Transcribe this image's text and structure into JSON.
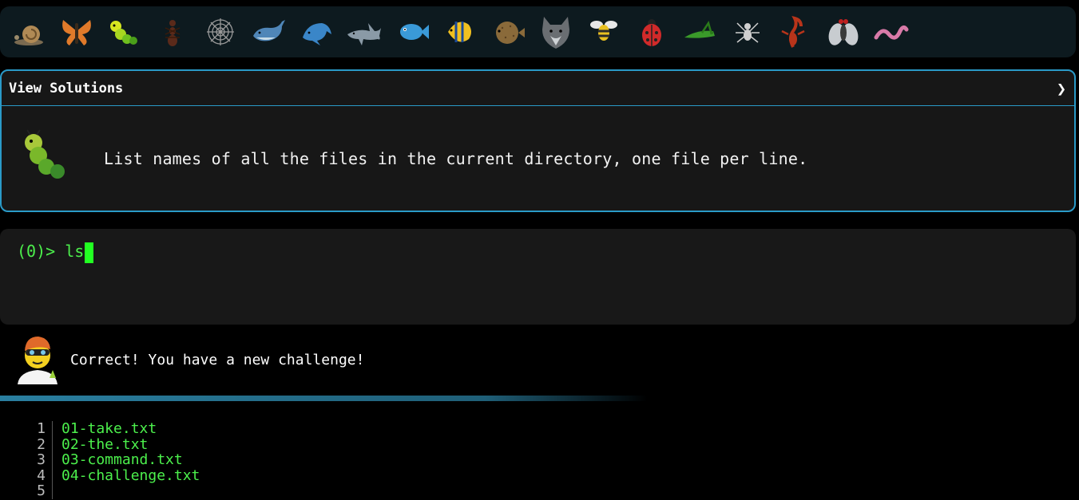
{
  "animal_bar": {
    "animals": [
      "snail-icon",
      "butterfly-icon",
      "caterpillar-icon",
      "ant-icon",
      "spider-web-icon",
      "whale-icon",
      "dolphin-icon",
      "shark-icon",
      "fish-icon",
      "tropical-fish-icon",
      "pufferfish-icon",
      "wolf-icon",
      "bee-icon",
      "ladybug-icon",
      "grasshopper-icon",
      "spider-icon",
      "scorpion-icon",
      "fly-icon",
      "worm-icon"
    ]
  },
  "solutions": {
    "title": "View Solutions",
    "toggle": "❯"
  },
  "challenge": {
    "icon": "caterpillar-icon",
    "text": "List names of all the files in the current directory, one file per line."
  },
  "terminal": {
    "prompt": "(0)> ",
    "input": "ls"
  },
  "feedback": {
    "avatar": "scientist-avatar",
    "message": "Correct! You have a new challenge!"
  },
  "output": {
    "lines": [
      {
        "num": "1",
        "text": "01-take.txt"
      },
      {
        "num": "2",
        "text": "02-the.txt"
      },
      {
        "num": "3",
        "text": "03-command.txt"
      },
      {
        "num": "4",
        "text": "04-challenge.txt"
      },
      {
        "num": "5",
        "text": ""
      }
    ]
  },
  "colors": {
    "accent": "#2a9ac8",
    "terminal_green": "#4cf04c",
    "cursor": "#22ff22"
  }
}
